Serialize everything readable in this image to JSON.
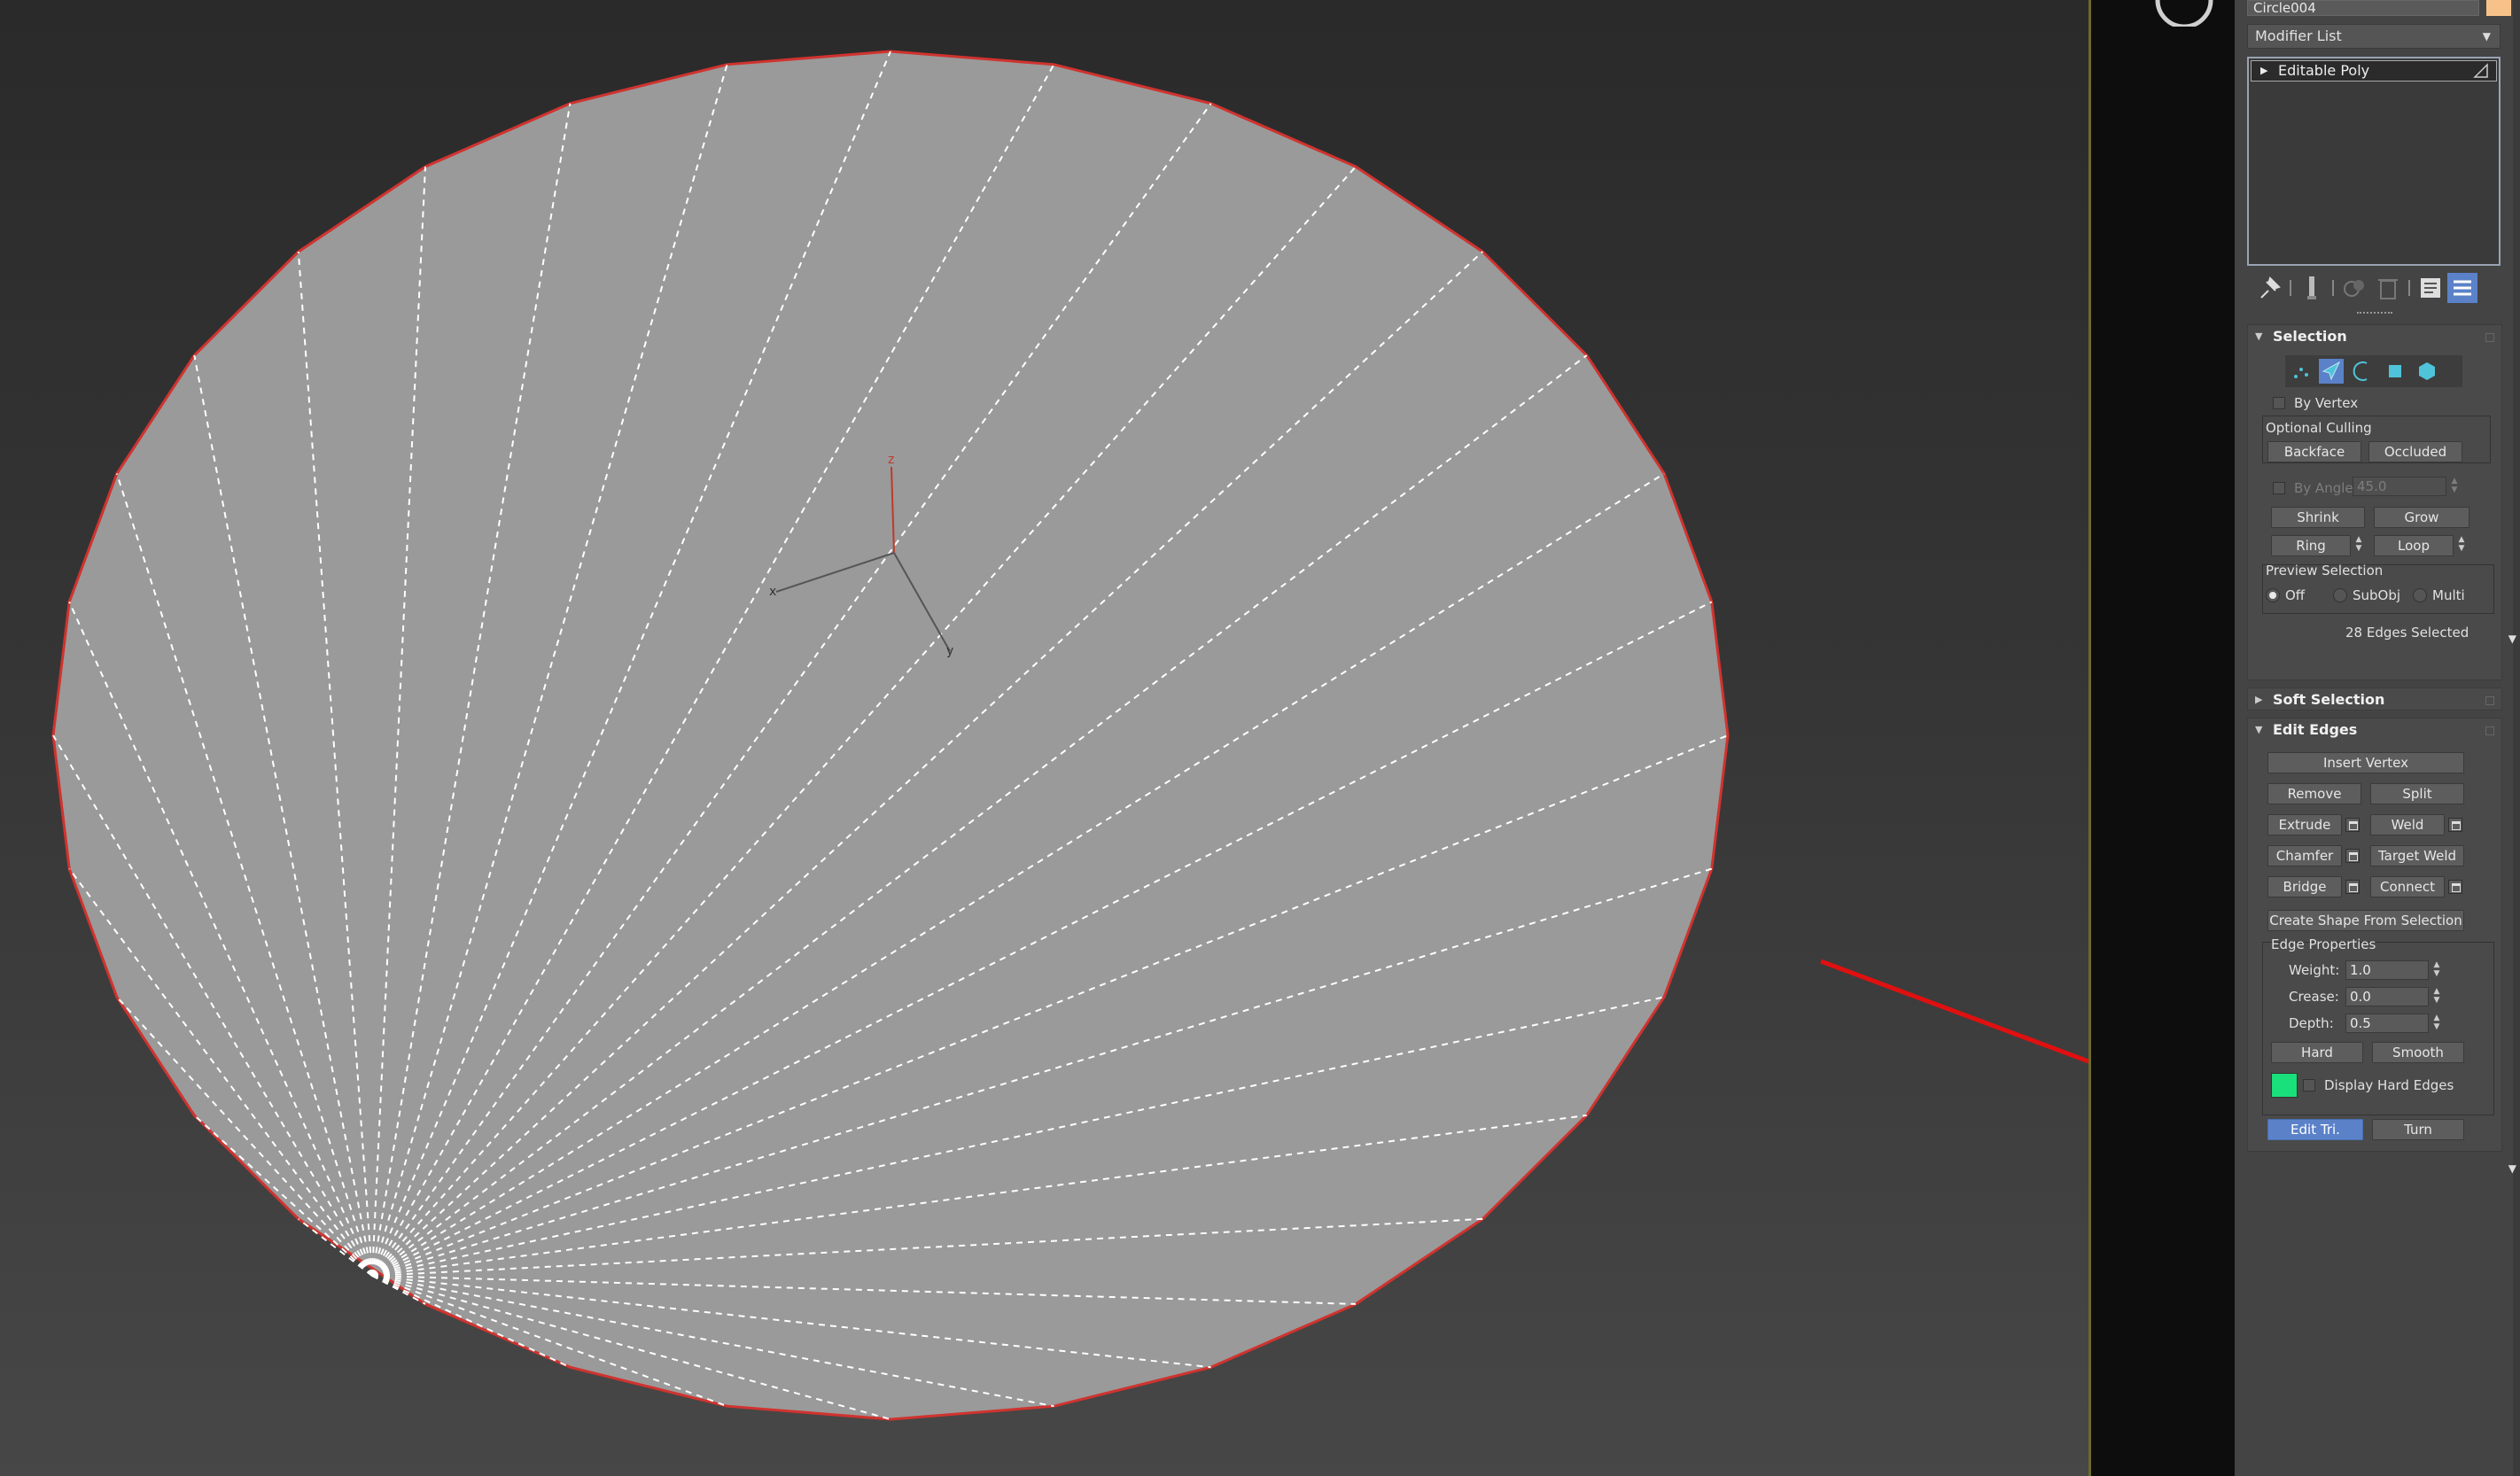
{
  "object_name": "Circle004",
  "modifier_list": "Modifier List",
  "stack": {
    "item": "Editable Poly"
  },
  "axes": {
    "z": "z",
    "x": "x",
    "y": "y"
  },
  "selection": {
    "title": "Selection",
    "by_vertex": "By Vertex",
    "optional_culling": "Optional Culling",
    "backface": "Backface",
    "occluded": "Occluded",
    "by_angle": "By Angle:",
    "by_angle_value": "45.0",
    "shrink": "Shrink",
    "grow": "Grow",
    "ring": "Ring",
    "loop": "Loop",
    "preview_selection": "Preview Selection",
    "preview_off": "Off",
    "preview_subobj": "SubObj",
    "preview_multi": "Multi",
    "status": "28 Edges Selected"
  },
  "soft_selection": {
    "title": "Soft Selection"
  },
  "edit_edges": {
    "title": "Edit Edges",
    "insert_vertex": "Insert Vertex",
    "remove": "Remove",
    "split": "Split",
    "extrude": "Extrude",
    "weld": "Weld",
    "chamfer": "Chamfer",
    "target_weld": "Target Weld",
    "bridge": "Bridge",
    "connect": "Connect",
    "create_shape": "Create Shape From Selection",
    "edge_properties": "Edge Properties",
    "weight_label": "Weight:",
    "weight_value": "1.0",
    "crease_label": "Crease:",
    "crease_value": "0.0",
    "depth_label": "Depth:",
    "depth_value": "0.5",
    "hard": "Hard",
    "smooth": "Smooth",
    "display_hard_edges": "Display Hard Edges",
    "edit_tri": "Edit Tri.",
    "turn": "Turn"
  },
  "colors": {
    "mesh_fill": "#9a9a9a",
    "mesh_outline": "#d0332f",
    "hard_edge_swatch": "#19e07a",
    "active_button": "#5b82c9",
    "annotation_arrow": "#e01010"
  },
  "icons": [
    "pin-stack-icon",
    "show-end-result-icon",
    "make-unique-icon",
    "remove-modifier-icon",
    "configure-modifier-sets-icon",
    "stack-menu-icon",
    "vertex-icon",
    "edge-icon",
    "border-icon",
    "polygon-icon",
    "element-icon"
  ]
}
